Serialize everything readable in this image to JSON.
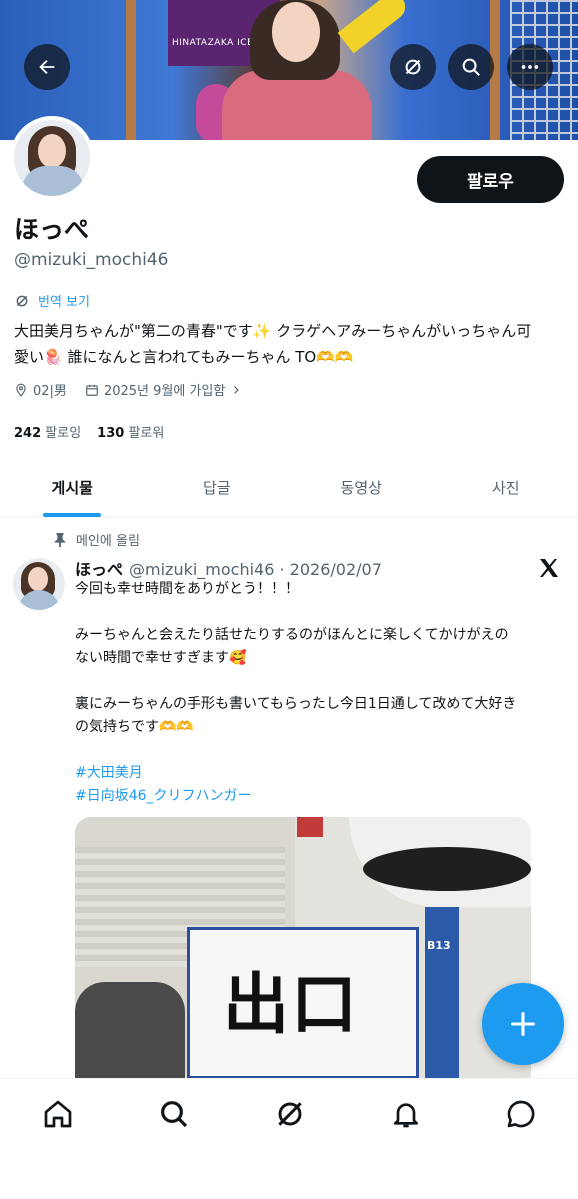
{
  "banner": {
    "panel_text": "HINATAZAKA ICE HOCKEY"
  },
  "profile": {
    "follow_label": "팔로우",
    "name": "ほっぺ",
    "handle": "@mizuki_mochi46",
    "translate_label": "번역 보기",
    "bio_line1": "大田美月ちゃんが\"第二の青春\"です✨ クラゲヘアみーちゃんがいっちゃん可",
    "bio_line2": "愛い🪼 誰になんと言われてもみーちゃん TO🫶🫶",
    "location": "02|男",
    "joined": "2025년 9월에 가입함",
    "following_count": "242",
    "following_label": "팔로잉",
    "followers_count": "130",
    "followers_label": "팔로워"
  },
  "tabs": [
    "게시물",
    "답글",
    "동영상",
    "사진"
  ],
  "active_tab": "게시물",
  "post": {
    "pinned_label": "메인에 올림",
    "author_name": "ほっぺ",
    "author_handle_date": "@mizuki_mochi46 · 2026/02/07",
    "line1": "今回も幸せ時間をありがとう！！！",
    "line2": "みーちゃんと会えたり話せたりするのがほんとに楽しくてかけがえの",
    "line3": "ない時間で幸せすぎます🥰",
    "line4": "裏にみーちゃんの手形も書いてもらったし今日1日通して改めて大好き",
    "line5": "の気持ちです🫶🫶",
    "hashtag1": "#大田美月",
    "hashtag2": "#日向坂46_クリフハンガー",
    "media": {
      "sign_text": "出口",
      "pillar_label": "B13"
    }
  },
  "icons": {
    "back": "back-arrow-icon",
    "grok": "grok-icon",
    "search": "search-icon",
    "more": "more-icon",
    "location": "location-pin-icon",
    "calendar": "calendar-icon",
    "compose": "plus-icon"
  },
  "colors": {
    "accent": "#1d9bf0",
    "primary_text": "#0f1419",
    "secondary_text": "#536471"
  }
}
